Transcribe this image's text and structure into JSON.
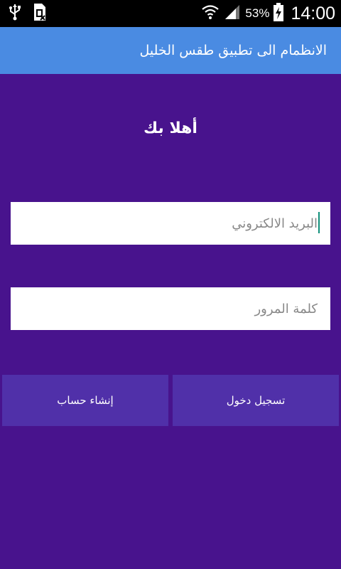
{
  "status_bar": {
    "left_icons": [
      "usb-icon",
      "sim-card-icon"
    ],
    "wifi_icon": "wifi-icon",
    "signal_icon": "signal-icon",
    "battery_percent": "53%",
    "battery_icon": "battery-charging-icon",
    "time": "14:00"
  },
  "app_bar": {
    "title": "الانظمام الى تطبيق طقس الخليل",
    "color": "#4a8be2"
  },
  "welcome_text": "أهلا بك",
  "form": {
    "email": {
      "placeholder": "البريد الالكتروني",
      "value": ""
    },
    "password": {
      "placeholder": "كلمة المرور",
      "value": ""
    }
  },
  "buttons": {
    "login_label": "تسجيل دخول",
    "signup_label": "إنشاء حساب"
  },
  "colors": {
    "background": "#48138d",
    "button": "#5030a9",
    "cursor": "#0f8f7a"
  }
}
